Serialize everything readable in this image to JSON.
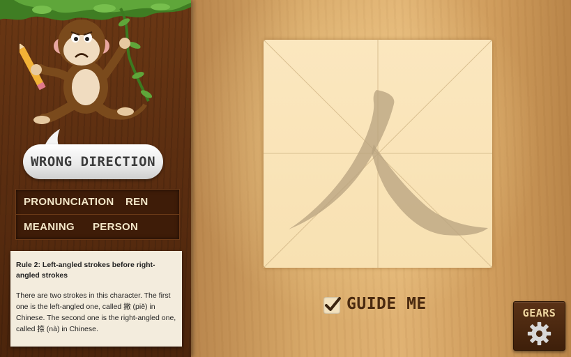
{
  "feedback": {
    "message": "WRONG DIRECTION"
  },
  "info": {
    "pronunciation_label": "PRONUNCIATION",
    "pronunciation_value": "REN",
    "meaning_label": "MEANING",
    "meaning_value": "PERSON"
  },
  "rule": {
    "title": "Rule 2: Left-angled strokes before right-angled strokes",
    "body": "There are two strokes in this character. The first one is the left-angled one, called 撇 (piě) in Chinese. The second one is the right-angled one, called 捺 (nà) in Chinese."
  },
  "board": {
    "character_icon": "ren-character-strokes"
  },
  "guide": {
    "label": "GUIDE ME",
    "checked": true
  },
  "settings": {
    "label": "GEARS",
    "icon": "gear-icon"
  },
  "mascot": {
    "icon": "monkey-with-pencil"
  },
  "colors": {
    "panel": "#5a2d10",
    "board": "#f8e1b2",
    "stroke": "#b9a384",
    "label": "#4a2a10"
  }
}
